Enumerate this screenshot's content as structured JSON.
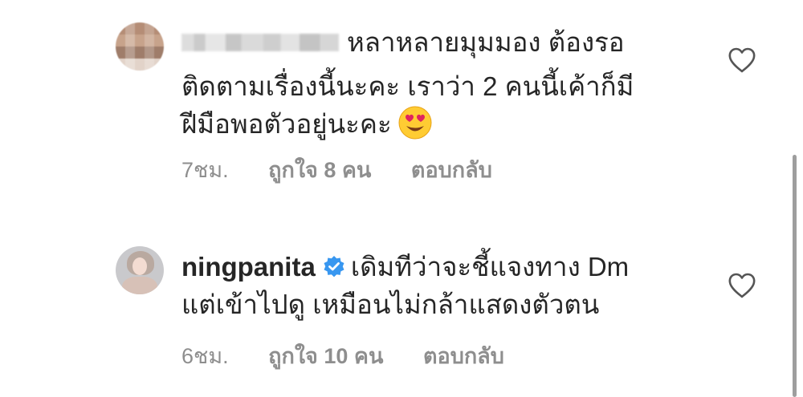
{
  "comments": [
    {
      "username": "",
      "lines": [
        "หลาหลายมุมมอง ต้องรอ",
        "ติดตามเรื่องนี้นะคะ เราว่า 2 คนนี้เค้าก็มี",
        "ฝีมือพอตัวอยู่นะคะ"
      ],
      "emoji": "heart-eyes-emoji",
      "time": "7ชม.",
      "likes": "ถูกใจ 8 คน",
      "reply": "ตอบกลับ",
      "verified": false
    },
    {
      "username": "ningpanita",
      "lines": [
        "เดิมทีว่าจะชี้แจงทาง Dm",
        "แต่เข้าไปดู เหมือนไม่กล้าแสดงตัวตน"
      ],
      "time": "6ชม.",
      "likes": "ถูกใจ 10 คน",
      "reply": "ตอบกลับ",
      "verified": true
    }
  ],
  "icons": {
    "like": "heart-outline-icon",
    "verified": "verified-badge-icon"
  },
  "colors": {
    "text": "#262626",
    "meta": "#8e8e8e",
    "verified": "#3897f0"
  }
}
